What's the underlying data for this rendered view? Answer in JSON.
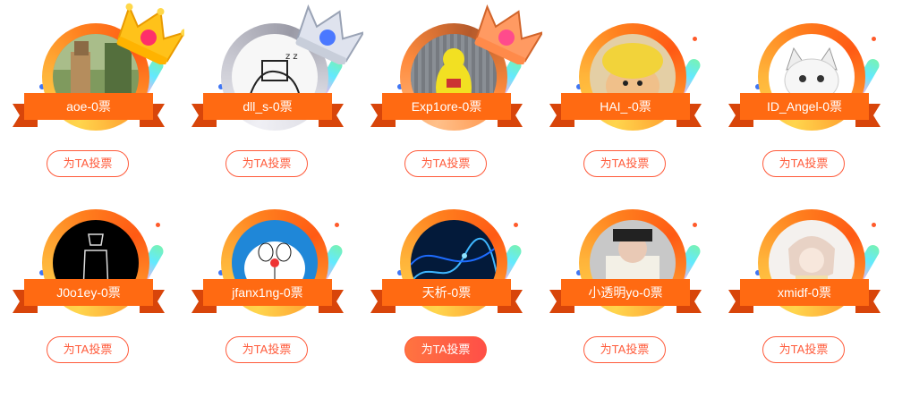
{
  "cards": [
    {
      "name_vote": "aoe-0票",
      "button": "为TA投票",
      "rank_badge": "gold-crown-1"
    },
    {
      "name_vote": "dll_s-0票",
      "button": "为TA投票",
      "rank_badge": "silver-crown-2"
    },
    {
      "name_vote": "Exp1ore-0票",
      "button": "为TA投票",
      "rank_badge": "bronze-crown-3"
    },
    {
      "name_vote": "HAI_-0票",
      "button": "为TA投票"
    },
    {
      "name_vote": "ID_Angel-0票",
      "button": "为TA投票"
    },
    {
      "name_vote": "J0o1ey-0票",
      "button": "为TA投票"
    },
    {
      "name_vote": "jfanx1ng-0票",
      "button": "为TA投票"
    },
    {
      "name_vote": "天析-0票",
      "button": "为TA投票",
      "button_state": "hover"
    },
    {
      "name_vote": "小透明yo-0票",
      "button": "为TA投票"
    },
    {
      "name_vote": "xmidf-0票",
      "button": "为TA投票"
    }
  ],
  "colors": {
    "ribbon": "#ff6a12",
    "ribbon_tail": "#d8450a",
    "vote_border": "#ff5a3a",
    "vote_active_start": "#ff7440",
    "vote_active_end": "#ff4f48"
  }
}
